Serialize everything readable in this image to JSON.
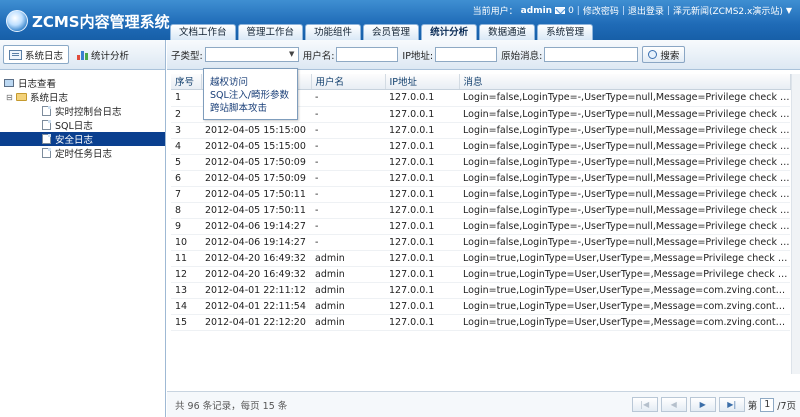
{
  "header": {
    "app_name": "ZCMS内容管理系统",
    "current_user_label": "当前用户：",
    "username": "admin",
    "mail_count": "0",
    "change_password": "修改密码",
    "logout": "退出登录",
    "site_selector": "泽元新闻(ZCMS2.x演示站)"
  },
  "nav_tabs": [
    {
      "label": "文档工作台"
    },
    {
      "label": "管理工作台"
    },
    {
      "label": "功能组件"
    },
    {
      "label": "会员管理"
    },
    {
      "label": "统计分析",
      "active": true
    },
    {
      "label": "数据通道"
    },
    {
      "label": "系统管理"
    }
  ],
  "left_tabs": [
    {
      "label": "系统日志",
      "active": true
    },
    {
      "label": "统计分析"
    }
  ],
  "tree": {
    "root": "日志查看",
    "group": "系统日志",
    "items": [
      {
        "label": "实时控制台日志"
      },
      {
        "label": "SQL日志"
      },
      {
        "label": "安全日志",
        "selected": true
      },
      {
        "label": "定时任务日志"
      }
    ]
  },
  "toolbar": {
    "subtype_label": "子类型:",
    "username_label": "用户名:",
    "ip_label": "IP地址:",
    "message_label": "原始消息:",
    "search_button": "搜索"
  },
  "subtype_options": [
    "越权访问",
    "SQL注入/畸形参数",
    "跨站脚本攻击"
  ],
  "table": {
    "headers": [
      "序号",
      "",
      "用户名",
      "IP地址",
      "消息"
    ],
    "rows": [
      {
        "no": "1",
        "time": "",
        "user": "-",
        "ip": "127.0.0.1",
        "msg": "Login=false,LoginType=-,UserType=null,Message=Privilege check failed:User i..."
      },
      {
        "no": "2",
        "time": "",
        "user": "-",
        "ip": "127.0.0.1",
        "msg": "Login=false,LoginType=-,UserType=null,Message=Privilege check failed:com...."
      },
      {
        "no": "3",
        "time": "2012-04-05 15:15:00",
        "user": "-",
        "ip": "127.0.0.1",
        "msg": "Login=false,LoginType=-,UserType=null,Message=Privilege check failed:User i..."
      },
      {
        "no": "4",
        "time": "2012-04-05 15:15:00",
        "user": "-",
        "ip": "127.0.0.1",
        "msg": "Login=false,LoginType=-,UserType=null,Message=Privilege check failed:com...."
      },
      {
        "no": "5",
        "time": "2012-04-05 17:50:09",
        "user": "-",
        "ip": "127.0.0.1",
        "msg": "Login=false,LoginType=-,UserType=null,Message=Privilege check failed:User i..."
      },
      {
        "no": "6",
        "time": "2012-04-05 17:50:09",
        "user": "-",
        "ip": "127.0.0.1",
        "msg": "Login=false,LoginType=-,UserType=null,Message=Privilege check failed:com...."
      },
      {
        "no": "7",
        "time": "2012-04-05 17:50:11",
        "user": "-",
        "ip": "127.0.0.1",
        "msg": "Login=false,LoginType=-,UserType=null,Message=Privilege check failed:User i..."
      },
      {
        "no": "8",
        "time": "2012-04-05 17:50:11",
        "user": "-",
        "ip": "127.0.0.1",
        "msg": "Login=false,LoginType=-,UserType=null,Message=Privilege check failed:com...."
      },
      {
        "no": "9",
        "time": "2012-04-06 19:14:27",
        "user": "-",
        "ip": "127.0.0.1",
        "msg": "Login=false,LoginType=-,UserType=null,Message=Privilege check failed:User i..."
      },
      {
        "no": "10",
        "time": "2012-04-06 19:14:27",
        "user": "-",
        "ip": "127.0.0.1",
        "msg": "Login=false,LoginType=-,UserType=null,Message=Privilege check failed:com...."
      },
      {
        "no": "11",
        "time": "2012-04-20 16:49:32",
        "user": "admin",
        "ip": "127.0.0.1",
        "msg": "Login=true,LoginType=User,UserType=,Message=Privilege check failed:Mem..."
      },
      {
        "no": "12",
        "time": "2012-04-20 16:49:32",
        "user": "admin",
        "ip": "127.0.0.1",
        "msg": "Login=true,LoginType=User,UserType=,Message=Privilege check failed:com...."
      },
      {
        "no": "13",
        "time": "2012-04-01 22:11:12",
        "user": "admin",
        "ip": "127.0.0.1",
        "msg": "Login=true,LoginType=User,UserType=,Message=com.zving.contentworkflo..."
      },
      {
        "no": "14",
        "time": "2012-04-01 22:11:54",
        "user": "admin",
        "ip": "127.0.0.1",
        "msg": "Login=true,LoginType=User,UserType=,Message=com.zving.contentworkflo..."
      },
      {
        "no": "15",
        "time": "2012-04-01 22:12:20",
        "user": "admin",
        "ip": "127.0.0.1",
        "msg": "Login=true,LoginType=User,UserType=,Message=com.zving.contentworkflo..."
      }
    ]
  },
  "footer": {
    "summary": "共 96 条记录，每页 15 条",
    "page_prefix": "第",
    "current_page": "1",
    "page_suffix": "/7页"
  },
  "pager_icons": [
    "first-page-icon",
    "prev-page-icon",
    "next-page-icon",
    "last-page-icon"
  ],
  "colors": {
    "header_blue": "#1f6bb7",
    "selected_node": "#0a3f8f"
  }
}
